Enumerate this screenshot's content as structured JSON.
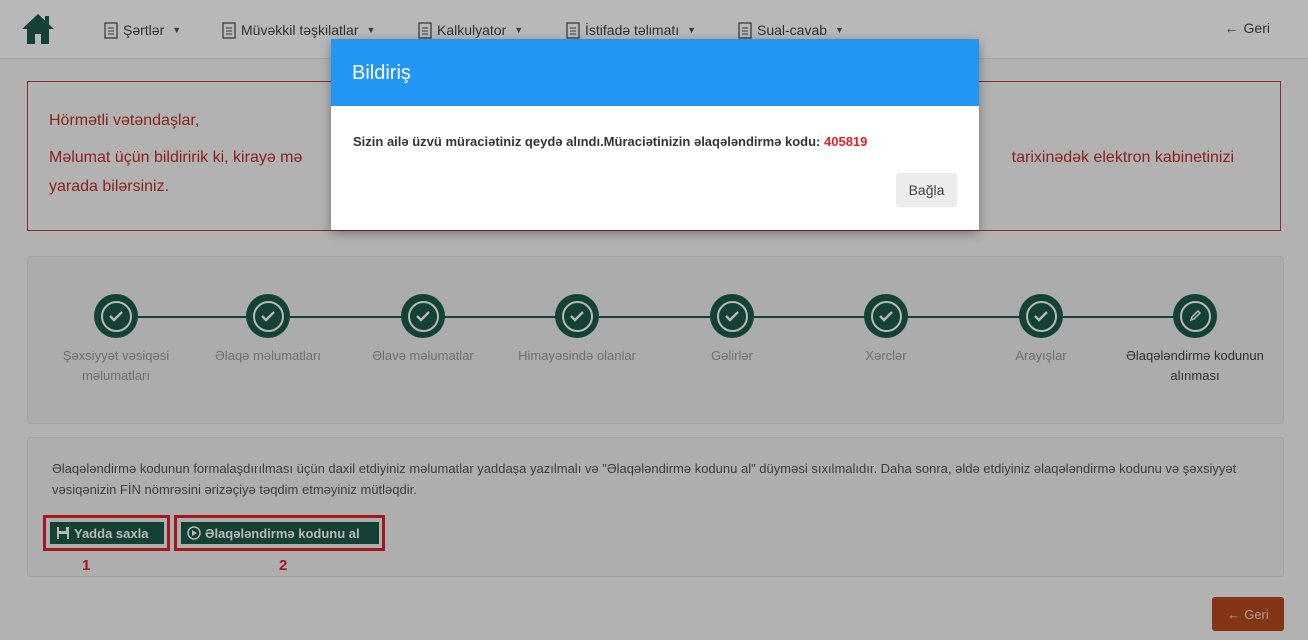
{
  "nav": {
    "items": [
      {
        "label": "Şərtlər"
      },
      {
        "label": "Müvəkkil təşkilatlar"
      },
      {
        "label": "Kalkulyator"
      },
      {
        "label": "İstifadə təlimatı"
      },
      {
        "label": "Sual-cavab"
      }
    ],
    "back_label": "Geri"
  },
  "alert": {
    "line1": "Hörmətli vətəndaşlar,",
    "line2_start": "Məlumat üçün bildiririk ki, kirayə mə",
    "line2_end": "tarixinədək elektron kabinetinizi",
    "line3": "yarada bilərsiniz."
  },
  "steps": [
    {
      "label": "Şəxsiyyət vəsiqəsi məlumatları",
      "status": "done"
    },
    {
      "label": "Əlaqə məlumatları",
      "status": "done"
    },
    {
      "label": "Əlavə məlumatlar",
      "status": "done"
    },
    {
      "label": "Himayəsində olanlar",
      "status": "done"
    },
    {
      "label": "Gəlirlər",
      "status": "done"
    },
    {
      "label": "Xərclər",
      "status": "done"
    },
    {
      "label": "Arayışlar",
      "status": "done"
    },
    {
      "label": "Əlaqələndirmə kodunun alınması",
      "status": "current"
    }
  ],
  "info": {
    "text": "Əlaqələndirmə kodunun formalaşdırılması üçün daxil etdiyiniz məlumatlar yaddaşa yazılmalı və \"Əlaqələndirmə kodunu al\" düyməsi sıxılmalıdır. Daha sonra, əldə etdiyiniz əlaqələndirmə kodunu və şəxsiyyət vəsiqənizin FİN nömrəsini ərizəçiyə təqdim etməyiniz mütləqdir.",
    "save_label": "Yadda saxla",
    "get_code_label": "Əlaqələndirmə kodunu al",
    "annotation_1": "1",
    "annotation_2": "2"
  },
  "bottom_back_label": "Geri",
  "modal": {
    "title": "Bildiriş",
    "message": "Sizin ailə üzvü müraciətiniz qeydə alındı.Müraciətinizin əlaqələndirmə kodu: ",
    "code": "405819",
    "close_label": "Bağla"
  },
  "colors": {
    "primary_green": "#1d5a4a",
    "alert_red": "#c0302b",
    "modal_blue": "#2196f3",
    "annotation_red": "#e2202a",
    "back_button": "#b84a1e"
  },
  "icons": {
    "home": "home-icon",
    "doc": "document-icon",
    "check": "check-icon",
    "pencil": "pencil-icon",
    "save": "floppy-disk-icon"
  }
}
